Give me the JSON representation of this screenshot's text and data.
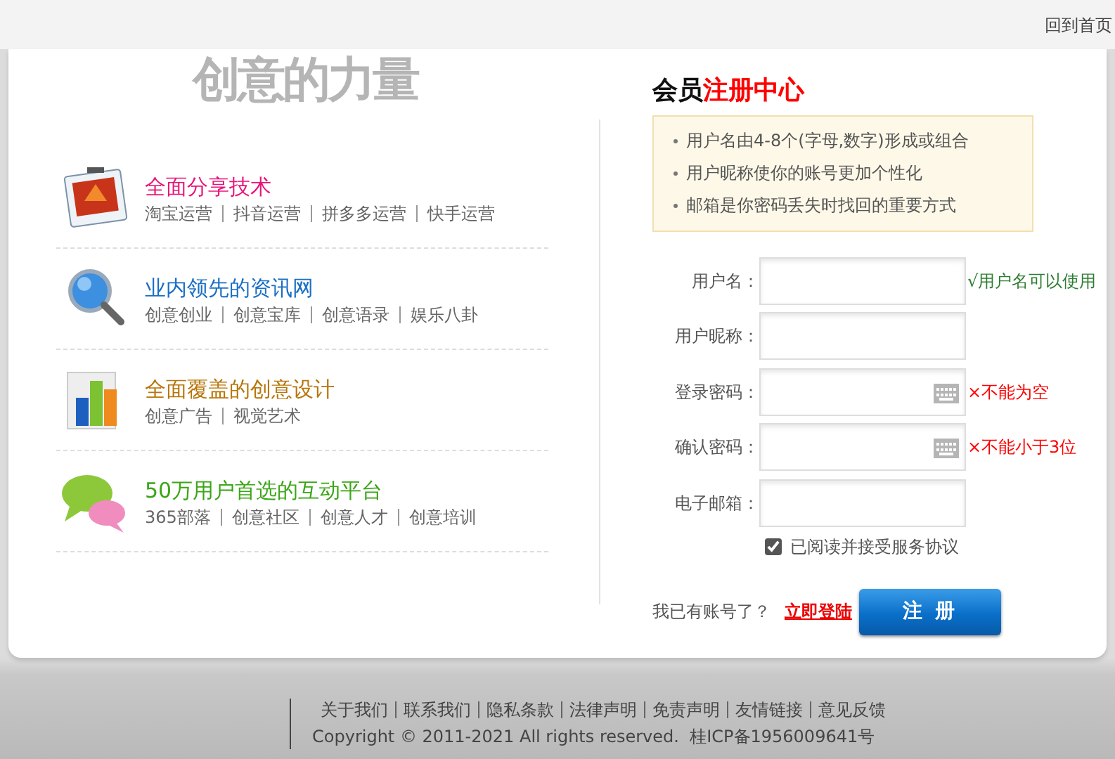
{
  "top_link": "回到首页",
  "logo": "创意的力量",
  "features": [
    {
      "title": "全面分享技术",
      "color": "#e8147a",
      "kind": "photo",
      "links": [
        "淘宝运营",
        "抖音运营",
        "拼多多运营",
        "快手运营"
      ]
    },
    {
      "title": "业内领先的资讯网",
      "color": "#1a6fc4",
      "kind": "magnifier",
      "links": [
        "创意创业",
        "创意宝库",
        "创意语录",
        "娱乐八卦"
      ]
    },
    {
      "title": "全面覆盖的创意设计",
      "color": "#b8750a",
      "kind": "chart",
      "links": [
        "创意广告",
        "视觉艺术"
      ]
    },
    {
      "title": "50万用户首选的互动平台",
      "color": "#3aa616",
      "kind": "bubbles",
      "links": [
        "365部落",
        "创意社区",
        "创意人才",
        "创意培训"
      ]
    }
  ],
  "register": {
    "title": "会员",
    "title_highlight": "注册中心",
    "tips": [
      "用户名由4-8个(字母,数字)形成或组合",
      "用户昵称使你的账号更加个性化",
      "邮箱是你密码丢失时找回的重要方式"
    ],
    "fields": [
      {
        "label": "用户名：",
        "kind": "text",
        "message": {
          "text": "√用户名可以使用",
          "kind": "ok"
        }
      },
      {
        "label": "用户昵称：",
        "kind": "text"
      },
      {
        "label": "登录密码：",
        "kind": "password",
        "message": {
          "text": "×不能为空",
          "kind": "error"
        }
      },
      {
        "label": "确认密码：",
        "kind": "password",
        "message": {
          "text": "×不能小于3位",
          "kind": "error"
        }
      },
      {
        "label": "电子邮箱：",
        "kind": "text"
      }
    ],
    "agreement": {
      "label": "已阅读并接受服务协议",
      "checked": true
    },
    "login_prompt": "我已有账号了？",
    "login_link": "立即登陆",
    "submit": "注 册"
  },
  "footer": {
    "links": [
      "关于我们",
      "联系我们",
      "隐私条款",
      "法律声明",
      "免责声明",
      "友情链接",
      "意见反馈"
    ],
    "copyright": "Copyright © 2011-2021 All rights reserved.  桂ICP备1956009641号"
  }
}
